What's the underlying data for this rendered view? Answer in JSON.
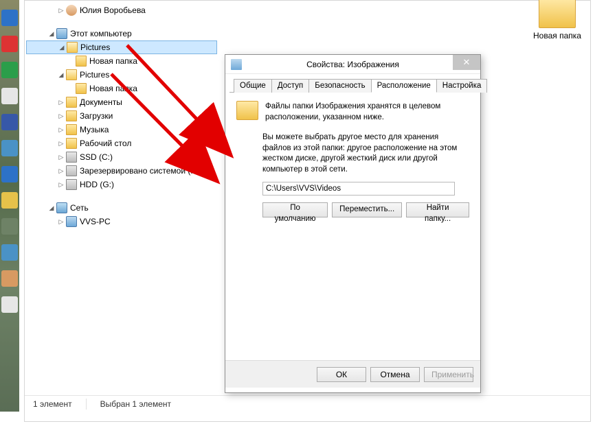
{
  "tree": {
    "user_name": "Юлия Воробьева",
    "computer": "Этот компьютер",
    "items": [
      {
        "label": "Pictures",
        "icon": "folder-open",
        "indent": 3,
        "expander": "open",
        "selected": true
      },
      {
        "label": "Новая папка",
        "icon": "folder",
        "indent": 4,
        "expander": "none"
      },
      {
        "label": "Pictures",
        "icon": "folder-open",
        "indent": 3,
        "expander": "open"
      },
      {
        "label": "Новая папка",
        "icon": "folder",
        "indent": 4,
        "expander": "none"
      },
      {
        "label": "Документы",
        "icon": "folder",
        "indent": 3,
        "expander": "closed"
      },
      {
        "label": "Загрузки",
        "icon": "folder",
        "indent": 3,
        "expander": "closed"
      },
      {
        "label": "Музыка",
        "icon": "folder",
        "indent": 3,
        "expander": "closed"
      },
      {
        "label": "Рабочий стол",
        "icon": "folder",
        "indent": 3,
        "expander": "closed"
      },
      {
        "label": "SSD (C:)",
        "icon": "drive",
        "indent": 3,
        "expander": "closed"
      },
      {
        "label": "Зарезервировано системой (F:)",
        "icon": "drive",
        "indent": 3,
        "expander": "closed"
      },
      {
        "label": "HDD (G:)",
        "icon": "drive",
        "indent": 3,
        "expander": "closed"
      }
    ],
    "network": "Сеть",
    "network_pc": "VVS-PC"
  },
  "content_folder": "Новая папка",
  "statusbar": {
    "count": "1 элемент",
    "selection": "Выбран 1 элемент"
  },
  "dialog": {
    "title": "Свойства: Изображения",
    "tabs": [
      "Общие",
      "Доступ",
      "Безопасность",
      "Расположение",
      "Настройка"
    ],
    "active_tab": 3,
    "info_text": "Файлы папки Изображения хранятся в целевом расположении, указанном ниже.",
    "desc_text": "Вы можете выбрать другое место для хранения файлов из этой папки: другое расположение на этом жестком диске, другой жесткий диск или другой компьютер в этой сети.",
    "path_value": "C:\\Users\\VVS\\Videos",
    "btn_default": "По умолчанию",
    "btn_move": "Переместить...",
    "btn_find": "Найти папку...",
    "btn_ok": "ОК",
    "btn_cancel": "Отмена",
    "btn_apply": "Применить"
  }
}
